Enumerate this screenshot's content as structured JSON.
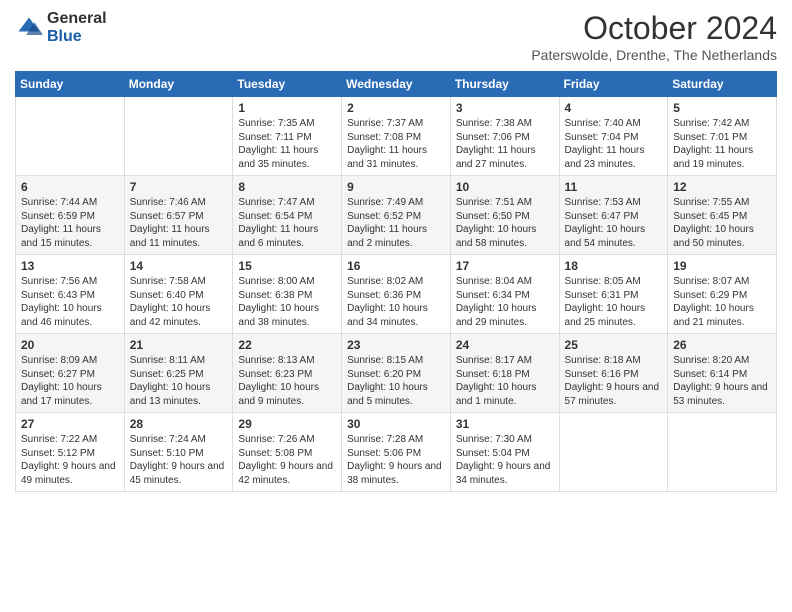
{
  "logo": {
    "general": "General",
    "blue": "Blue"
  },
  "header": {
    "month": "October 2024",
    "location": "Paterswolde, Drenthe, The Netherlands"
  },
  "days_of_week": [
    "Sunday",
    "Monday",
    "Tuesday",
    "Wednesday",
    "Thursday",
    "Friday",
    "Saturday"
  ],
  "weeks": [
    [
      {
        "day": "",
        "sunrise": "",
        "sunset": "",
        "daylight": ""
      },
      {
        "day": "",
        "sunrise": "",
        "sunset": "",
        "daylight": ""
      },
      {
        "day": "1",
        "sunrise": "Sunrise: 7:35 AM",
        "sunset": "Sunset: 7:11 PM",
        "daylight": "Daylight: 11 hours and 35 minutes."
      },
      {
        "day": "2",
        "sunrise": "Sunrise: 7:37 AM",
        "sunset": "Sunset: 7:08 PM",
        "daylight": "Daylight: 11 hours and 31 minutes."
      },
      {
        "day": "3",
        "sunrise": "Sunrise: 7:38 AM",
        "sunset": "Sunset: 7:06 PM",
        "daylight": "Daylight: 11 hours and 27 minutes."
      },
      {
        "day": "4",
        "sunrise": "Sunrise: 7:40 AM",
        "sunset": "Sunset: 7:04 PM",
        "daylight": "Daylight: 11 hours and 23 minutes."
      },
      {
        "day": "5",
        "sunrise": "Sunrise: 7:42 AM",
        "sunset": "Sunset: 7:01 PM",
        "daylight": "Daylight: 11 hours and 19 minutes."
      }
    ],
    [
      {
        "day": "6",
        "sunrise": "Sunrise: 7:44 AM",
        "sunset": "Sunset: 6:59 PM",
        "daylight": "Daylight: 11 hours and 15 minutes."
      },
      {
        "day": "7",
        "sunrise": "Sunrise: 7:46 AM",
        "sunset": "Sunset: 6:57 PM",
        "daylight": "Daylight: 11 hours and 11 minutes."
      },
      {
        "day": "8",
        "sunrise": "Sunrise: 7:47 AM",
        "sunset": "Sunset: 6:54 PM",
        "daylight": "Daylight: 11 hours and 6 minutes."
      },
      {
        "day": "9",
        "sunrise": "Sunrise: 7:49 AM",
        "sunset": "Sunset: 6:52 PM",
        "daylight": "Daylight: 11 hours and 2 minutes."
      },
      {
        "day": "10",
        "sunrise": "Sunrise: 7:51 AM",
        "sunset": "Sunset: 6:50 PM",
        "daylight": "Daylight: 10 hours and 58 minutes."
      },
      {
        "day": "11",
        "sunrise": "Sunrise: 7:53 AM",
        "sunset": "Sunset: 6:47 PM",
        "daylight": "Daylight: 10 hours and 54 minutes."
      },
      {
        "day": "12",
        "sunrise": "Sunrise: 7:55 AM",
        "sunset": "Sunset: 6:45 PM",
        "daylight": "Daylight: 10 hours and 50 minutes."
      }
    ],
    [
      {
        "day": "13",
        "sunrise": "Sunrise: 7:56 AM",
        "sunset": "Sunset: 6:43 PM",
        "daylight": "Daylight: 10 hours and 46 minutes."
      },
      {
        "day": "14",
        "sunrise": "Sunrise: 7:58 AM",
        "sunset": "Sunset: 6:40 PM",
        "daylight": "Daylight: 10 hours and 42 minutes."
      },
      {
        "day": "15",
        "sunrise": "Sunrise: 8:00 AM",
        "sunset": "Sunset: 6:38 PM",
        "daylight": "Daylight: 10 hours and 38 minutes."
      },
      {
        "day": "16",
        "sunrise": "Sunrise: 8:02 AM",
        "sunset": "Sunset: 6:36 PM",
        "daylight": "Daylight: 10 hours and 34 minutes."
      },
      {
        "day": "17",
        "sunrise": "Sunrise: 8:04 AM",
        "sunset": "Sunset: 6:34 PM",
        "daylight": "Daylight: 10 hours and 29 minutes."
      },
      {
        "day": "18",
        "sunrise": "Sunrise: 8:05 AM",
        "sunset": "Sunset: 6:31 PM",
        "daylight": "Daylight: 10 hours and 25 minutes."
      },
      {
        "day": "19",
        "sunrise": "Sunrise: 8:07 AM",
        "sunset": "Sunset: 6:29 PM",
        "daylight": "Daylight: 10 hours and 21 minutes."
      }
    ],
    [
      {
        "day": "20",
        "sunrise": "Sunrise: 8:09 AM",
        "sunset": "Sunset: 6:27 PM",
        "daylight": "Daylight: 10 hours and 17 minutes."
      },
      {
        "day": "21",
        "sunrise": "Sunrise: 8:11 AM",
        "sunset": "Sunset: 6:25 PM",
        "daylight": "Daylight: 10 hours and 13 minutes."
      },
      {
        "day": "22",
        "sunrise": "Sunrise: 8:13 AM",
        "sunset": "Sunset: 6:23 PM",
        "daylight": "Daylight: 10 hours and 9 minutes."
      },
      {
        "day": "23",
        "sunrise": "Sunrise: 8:15 AM",
        "sunset": "Sunset: 6:20 PM",
        "daylight": "Daylight: 10 hours and 5 minutes."
      },
      {
        "day": "24",
        "sunrise": "Sunrise: 8:17 AM",
        "sunset": "Sunset: 6:18 PM",
        "daylight": "Daylight: 10 hours and 1 minute."
      },
      {
        "day": "25",
        "sunrise": "Sunrise: 8:18 AM",
        "sunset": "Sunset: 6:16 PM",
        "daylight": "Daylight: 9 hours and 57 minutes."
      },
      {
        "day": "26",
        "sunrise": "Sunrise: 8:20 AM",
        "sunset": "Sunset: 6:14 PM",
        "daylight": "Daylight: 9 hours and 53 minutes."
      }
    ],
    [
      {
        "day": "27",
        "sunrise": "Sunrise: 7:22 AM",
        "sunset": "Sunset: 5:12 PM",
        "daylight": "Daylight: 9 hours and 49 minutes."
      },
      {
        "day": "28",
        "sunrise": "Sunrise: 7:24 AM",
        "sunset": "Sunset: 5:10 PM",
        "daylight": "Daylight: 9 hours and 45 minutes."
      },
      {
        "day": "29",
        "sunrise": "Sunrise: 7:26 AM",
        "sunset": "Sunset: 5:08 PM",
        "daylight": "Daylight: 9 hours and 42 minutes."
      },
      {
        "day": "30",
        "sunrise": "Sunrise: 7:28 AM",
        "sunset": "Sunset: 5:06 PM",
        "daylight": "Daylight: 9 hours and 38 minutes."
      },
      {
        "day": "31",
        "sunrise": "Sunrise: 7:30 AM",
        "sunset": "Sunset: 5:04 PM",
        "daylight": "Daylight: 9 hours and 34 minutes."
      },
      {
        "day": "",
        "sunrise": "",
        "sunset": "",
        "daylight": ""
      },
      {
        "day": "",
        "sunrise": "",
        "sunset": "",
        "daylight": ""
      }
    ]
  ]
}
